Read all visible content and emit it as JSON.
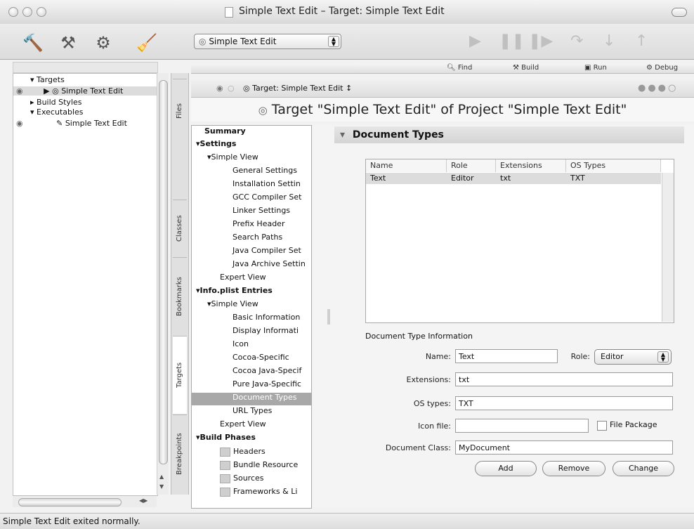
{
  "window": {
    "title": "Simple Text Edit – Target: Simple Text Edit"
  },
  "toolbar": {
    "tools": [
      "hammer-icon",
      "build-and-run-icon",
      "build-and-debug-icon",
      "clean-icon"
    ],
    "target_popup": "Simple Text Edit",
    "controls": [
      "run-icon",
      "pause-icon",
      "continue-icon",
      "step-over-icon",
      "step-into-icon",
      "step-out-icon"
    ]
  },
  "outline": {
    "items": [
      {
        "label": "Targets"
      },
      {
        "label": "Simple Text Edit"
      },
      {
        "label": "Build Styles"
      },
      {
        "label": "Executables"
      },
      {
        "label": "Simple Text Edit"
      }
    ]
  },
  "side_tabs": [
    "Files",
    "Classes",
    "Bookmarks",
    "Targets",
    "Breakpoints"
  ],
  "top_buttons": [
    "Find",
    "Build",
    "Run",
    "Debug"
  ],
  "editor_bar": {
    "path": "Target: Simple Text Edit"
  },
  "heading": "Target \"Simple Text Edit\" of Project \"Simple Text Edit\"",
  "nav": {
    "items": [
      {
        "label": "Summary"
      },
      {
        "label": "Settings"
      },
      {
        "label": "Simple View"
      },
      {
        "label": "General Settings"
      },
      {
        "label": "Installation Settin"
      },
      {
        "label": "GCC Compiler Set"
      },
      {
        "label": "Linker Settings"
      },
      {
        "label": "Prefix Header"
      },
      {
        "label": "Search Paths"
      },
      {
        "label": "Java Compiler Set"
      },
      {
        "label": "Java Archive Settin"
      },
      {
        "label": "Expert View"
      },
      {
        "label": "Info.plist Entries"
      },
      {
        "label": "Simple View"
      },
      {
        "label": "Basic Information"
      },
      {
        "label": "Display Informati"
      },
      {
        "label": "Icon"
      },
      {
        "label": "Cocoa-Specific"
      },
      {
        "label": "Cocoa Java-Specif"
      },
      {
        "label": "Pure Java-Specific"
      },
      {
        "label": "Document Types"
      },
      {
        "label": "URL Types"
      },
      {
        "label": "Expert View"
      },
      {
        "label": "Build Phases"
      },
      {
        "label": "Headers"
      },
      {
        "label": "Bundle Resource"
      },
      {
        "label": "Sources"
      },
      {
        "label": "Frameworks & Li"
      }
    ]
  },
  "section": {
    "title": "Document Types"
  },
  "doc_table": {
    "columns": [
      "Name",
      "Role",
      "Extensions",
      "OS Types"
    ],
    "rows": [
      [
        "Text",
        "Editor",
        "txt",
        "TXT"
      ]
    ]
  },
  "doc_info": {
    "heading": "Document Type Information",
    "name_label": "Name:",
    "name_value": "Text",
    "role_label": "Role:",
    "role_value": "Editor",
    "ext_label": "Extensions:",
    "ext_value": "txt",
    "os_label": "OS types:",
    "os_value": "TXT",
    "icon_label": "Icon file:",
    "icon_value": "",
    "file_package_label": "File Package",
    "class_label": "Document Class:",
    "class_value": "MyDocument",
    "add": "Add",
    "remove": "Remove",
    "change": "Change"
  },
  "status": {
    "text": "Simple Text Edit exited normally."
  }
}
